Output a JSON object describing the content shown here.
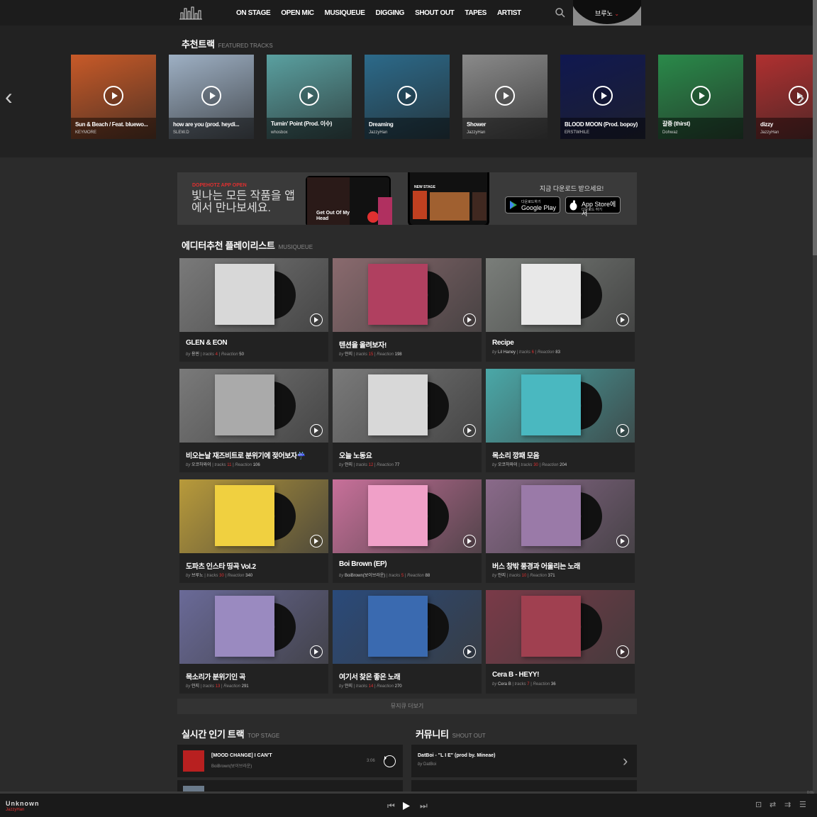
{
  "header": {
    "nav": [
      "ON STAGE",
      "OPEN MIC",
      "MUSIQUEUE",
      "DIGGING",
      "SHOUT OUT",
      "TAPES",
      "ARTIST"
    ],
    "user": "브루노"
  },
  "featured": {
    "title": "추천트랙",
    "subtitle": "FEATURED TRACKS",
    "tracks": [
      {
        "title": "Sun & Beach / Feat. bluewo...",
        "artist": "KEYMORE",
        "color": "#c85a28"
      },
      {
        "title": "how are you (prod. heydi...",
        "artist": "SLEW.D",
        "color": "#9eb0c4"
      },
      {
        "title": "Turnin' Point (Prod. 이수)",
        "artist": "whosbox",
        "color": "#5aa0a0"
      },
      {
        "title": "Dreaming",
        "artist": "JazzyHan",
        "color": "#2c6a8a"
      },
      {
        "title": "Shower",
        "artist": "JazzyHan",
        "color": "#8a8a8a"
      },
      {
        "title": "BLOOD MOON (Prod. bopoy)",
        "artist": "ERSTWHILE",
        "color": "#101850"
      },
      {
        "title": "갈증 (thirst)",
        "artist": "Dohwaz",
        "color": "#2a8a4a"
      },
      {
        "title": "dizzy",
        "artist": "JazzyHan",
        "color": "#b03030"
      }
    ]
  },
  "banner": {
    "tag": "DOPEHOTZ APP OPEN",
    "message": "빛나는 모든 작품을 앱에서 만나보세요.",
    "download": "지금 다운로드 받으세요!",
    "google_small": "다운로드하기",
    "google": "Google Play",
    "apple": "App Store에서",
    "apple_small": "다운로드 하기",
    "phone_label": "NEW STAGE",
    "tablet_label": "Get Out Of My Head"
  },
  "playlists": {
    "title": "에디터추천 플레이리스트",
    "subtitle": "MUSIQUEUE",
    "by_label": "by",
    "tracks_label": "tracks",
    "reaction_label": "Reaction",
    "items": [
      {
        "title": "GLEN & EON",
        "by": "용핀",
        "tracks": "4",
        "reaction": "50",
        "bg": "#7a7a7a",
        "art": "#d8d8d8"
      },
      {
        "title": "텐션을 올려보자!",
        "by": "얀지",
        "tracks": "15",
        "reaction": "198",
        "bg": "#8a6a6e",
        "art": "#b04060"
      },
      {
        "title": "Recipe",
        "by": "Lil Haney",
        "tracks": "6",
        "reaction": "83",
        "bg": "#7a7e7a",
        "art": "#e8e8e8"
      },
      {
        "title": "비오는날 재즈비트로 분위기에 젖어보자☔",
        "by": "오코하와이",
        "tracks": "11",
        "reaction": "106",
        "bg": "#7a7a7a",
        "art": "#aaaaaa"
      },
      {
        "title": "오늘 노동요",
        "by": "얀지",
        "tracks": "12",
        "reaction": "77",
        "bg": "#7a7a7a",
        "art": "#d8d8d8"
      },
      {
        "title": "목소리 깡패 모음",
        "by": "오코하와이",
        "tracks": "30",
        "reaction": "204",
        "bg": "#4aa8a8",
        "art": "#4ab8c0"
      },
      {
        "title": "도파츠 인스타 띵곡 Vol.2",
        "by": "브루노",
        "tracks": "30",
        "reaction": "340",
        "bg": "#b89a3a",
        "art": "#f0d040"
      },
      {
        "title": "Boi Brown (EP)",
        "by": "BoiBrown(보이브라운)",
        "tracks": "5",
        "reaction": "88",
        "bg": "#c8709a",
        "art": "#f0a0c8"
      },
      {
        "title": "버스 창밖 풍경과 어울리는 노래",
        "by": "얀지",
        "tracks": "10",
        "reaction": "371",
        "bg": "#8a6a8a",
        "art": "#9a7aa8"
      },
      {
        "title": "목소리가 분위기인 곡",
        "by": "얀지",
        "tracks": "13",
        "reaction": "291",
        "bg": "#6a6a98",
        "art": "#9a8ac0"
      },
      {
        "title": "여기서 찾은 좋은 노래",
        "by": "얀지",
        "tracks": "14",
        "reaction": "270",
        "bg": "#2a4a7a",
        "art": "#3a6ab0"
      },
      {
        "title": "Cera B - HEYY!",
        "by": "Cera B",
        "tracks": "7",
        "reaction": "36",
        "bg": "#7a3a48",
        "art": "#a04050"
      }
    ],
    "more": "뮤지큐 더보기"
  },
  "top_stage": {
    "title": "실시간 인기 트랙",
    "subtitle": "TOP STAGE",
    "items": [
      {
        "title": "[MOOD CHANGE] I CAN'T",
        "artist": "BoiBrown(보이브라운)",
        "duration": "3:06"
      }
    ]
  },
  "shout_out": {
    "title": "커뮤니티",
    "subtitle": "SHOUT OUT",
    "items": [
      {
        "title": "DatBoi - \"L I E\" (prod by. Mineae)",
        "by": "DatBoi"
      }
    ]
  },
  "player": {
    "title": "Unknown",
    "artist": "JazzyHan",
    "time": "0:00"
  },
  "colors": {
    "accent": "#e03030",
    "bg": "#2b2b2b",
    "topbar": "#1c1c1c"
  }
}
